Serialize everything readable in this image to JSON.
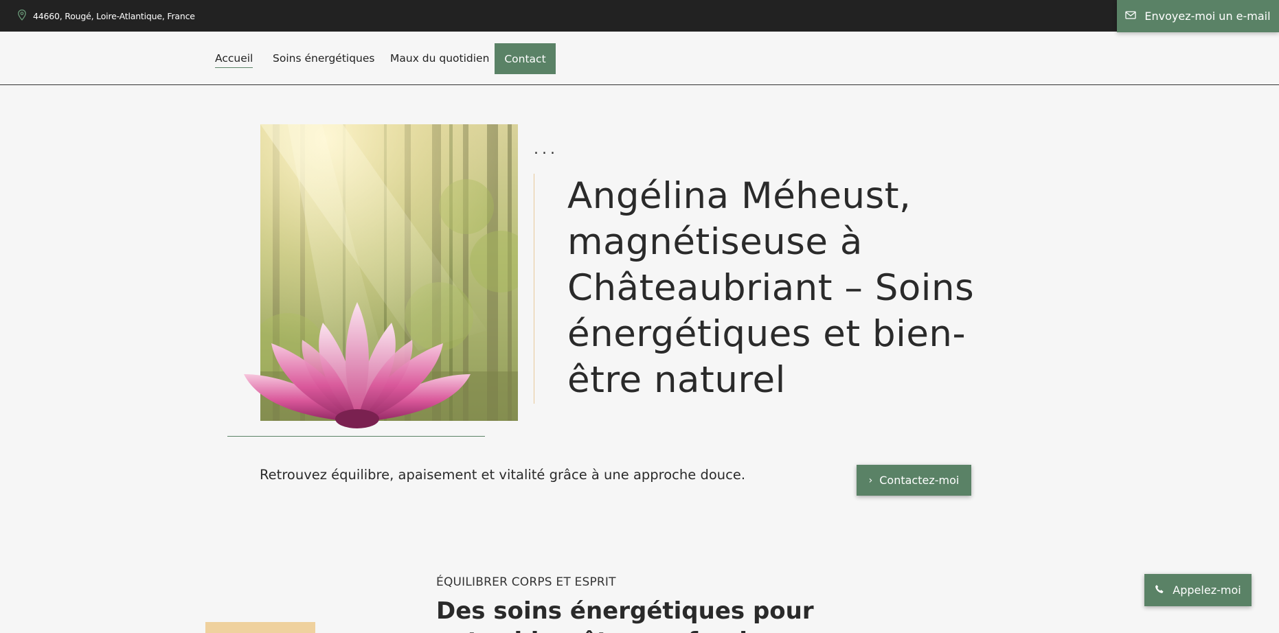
{
  "topbar": {
    "location": "44660, Rougé, Loire-Atlantique, France",
    "email_label": "Envoyez-moi un e-mail"
  },
  "nav": {
    "items": [
      {
        "label": "Accueil",
        "active": true
      },
      {
        "label": "Soins énergétiques",
        "active": false
      },
      {
        "label": "Maux du quotidien",
        "active": false
      }
    ],
    "contact_label": "Contact"
  },
  "hero": {
    "dots": "...",
    "title": "Angélina Méheust, magnétiseuse à Châteaubriant – Soins énergétiques et bien-être naturel",
    "subtitle": "Retrouvez équilibre, apaisement et vitalité grâce à une approche douce.",
    "cta_label": "Contactez-moi"
  },
  "section": {
    "kicker": "ÉQUILIBRER CORPS ET ESPRIT",
    "title": "Des soins énergétiques pour votre bien-être profond"
  },
  "call": {
    "label": "Appelez-moi"
  },
  "colors": {
    "accent": "#5a8266",
    "topbar": "#222222",
    "background": "#f6f6f6",
    "beige": "#efd19e"
  }
}
